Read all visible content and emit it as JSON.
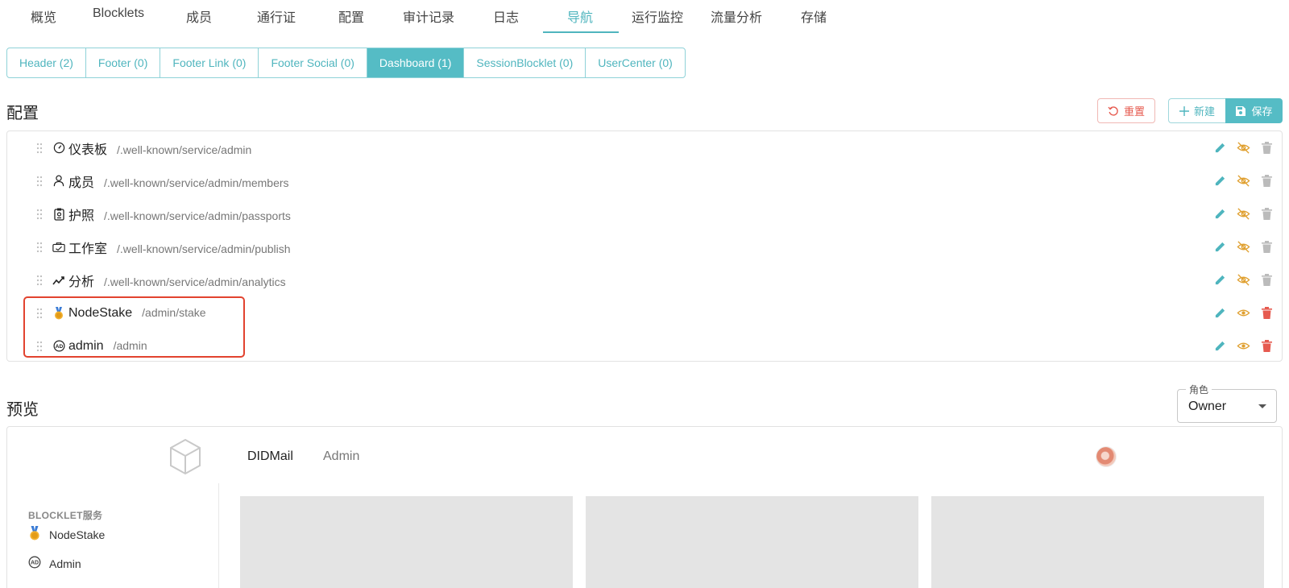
{
  "top_nav": {
    "tabs": [
      "概览",
      "Blocklets",
      "成员",
      "通行证",
      "配置",
      "审计记录",
      "日志",
      "导航",
      "运行监控",
      "流量分析",
      "存储"
    ],
    "active_index": 7
  },
  "segments": {
    "items": [
      "Header (2)",
      "Footer (0)",
      "Footer Link (0)",
      "Footer Social (0)",
      "Dashboard (1)",
      "SessionBlocklet (0)",
      "UserCenter (0)"
    ],
    "active_index": 4
  },
  "config": {
    "title": "配置",
    "reset_label": "重置",
    "new_label": "新建",
    "save_label": "保存"
  },
  "nav_items": [
    {
      "title": "仪表板",
      "path": "/.well-known/service/admin",
      "icon": "dashboard-icon",
      "visible": false
    },
    {
      "title": "成员",
      "path": "/.well-known/service/admin/members",
      "icon": "user-icon",
      "visible": false
    },
    {
      "title": "护照",
      "path": "/.well-known/service/admin/passports",
      "icon": "passport-icon",
      "visible": false
    },
    {
      "title": "工作室",
      "path": "/.well-known/service/admin/publish",
      "icon": "studio-icon",
      "visible": false
    },
    {
      "title": "分析",
      "path": "/.well-known/service/admin/analytics",
      "icon": "analytics-icon",
      "visible": false
    },
    {
      "title": "NodeStake",
      "path": "/admin/stake",
      "icon": "medal-icon",
      "visible": true
    },
    {
      "title": "admin",
      "path": "/admin",
      "icon": "ad-icon",
      "visible": true
    }
  ],
  "preview": {
    "title": "预览",
    "role_label": "角色",
    "role_value": "Owner",
    "app_name": "DIDMail",
    "app_nav_item": "Admin",
    "sidebar_section": "BLOCKLET服务",
    "sidebar_items": [
      {
        "label": "NodeStake",
        "icon": "medal-icon"
      },
      {
        "label": "Admin",
        "icon": "ad-icon"
      }
    ]
  },
  "colors": {
    "accent": "#55bcc5",
    "danger": "#e65a4f",
    "warning": "#e0a030",
    "highlight_box": "#e2432f"
  }
}
